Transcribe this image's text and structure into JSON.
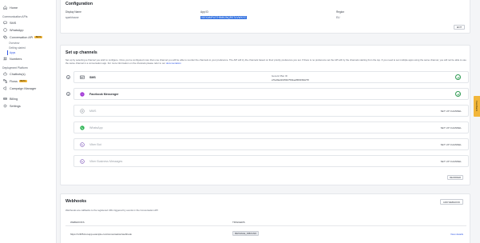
{
  "sidebar": {
    "top_items": [
      {
        "label": "Home",
        "icon": "home-icon"
      }
    ],
    "comm_section": "Communication APIs",
    "comm_items": [
      {
        "label": "SMS",
        "icon": "sms-icon"
      },
      {
        "label": "WhatsApp",
        "icon": "whatsapp-icon"
      },
      {
        "label": "Conversation API",
        "icon": "conversation-icon",
        "badge": "BETA"
      }
    ],
    "conv_sub": [
      {
        "label": "Overview"
      },
      {
        "label": "Getting started"
      },
      {
        "label": "Apps"
      }
    ],
    "numbers": {
      "label": "Numbers",
      "icon": "numbers-icon"
    },
    "deploy_section": "Deployment Platform",
    "deploy_items": [
      {
        "label": "Chatbots(s)",
        "icon": "chatbot-icon"
      },
      {
        "label": "Flows",
        "icon": "flows-icon",
        "badge": "BETA"
      },
      {
        "label": "Campaign Manager",
        "icon": "campaign-icon"
      }
    ],
    "bottom_items": [
      {
        "label": "Billing",
        "icon": "billing-icon"
      },
      {
        "label": "Settings",
        "icon": "settings-icon"
      }
    ]
  },
  "config": {
    "title": "Configuration",
    "display_name_label": "Display Name",
    "display_name_value": "sparkhouse",
    "app_id_label": "App ID",
    "app_id_value": "01EXAMPLE7H9MK2NQRSTUVWXYZ",
    "region_label": "Region",
    "region_value": "EU",
    "edit_label": "EDIT"
  },
  "channels": {
    "title": "Set up channels",
    "desc_line1": "Set up by selecting a channel you wish to configure. Once you've configured more than one channel you will be able to reorder the channels to your preference. The API will try the channels based on their priority preference you set. If there is no preference set the API will try the channels starting from the top. If you need to set multiple",
    "desc_line2": "apps using the same channel, you will not be able to use the same channel in a conversation app. For more information on the channels please refer to our",
    "desc_link": "documentation",
    "steps": [
      "1",
      "2"
    ],
    "configured": [
      {
        "name": "SMS",
        "meta_label": "Generic Plan ID",
        "meta_value": "a7fe29ad1b354b7592aef809036d278"
      },
      {
        "name": "Facebook Messenger"
      }
    ],
    "available": [
      {
        "name": "MMS",
        "action": "SET UP CHANNEL"
      },
      {
        "name": "WhatsApp",
        "action": "SET UP CHANNEL"
      },
      {
        "name": "Viber Bot",
        "action": "SET UP CHANNEL"
      },
      {
        "name": "Viber Business Messages",
        "action": "SET UP CHANNEL"
      }
    ],
    "reorder_label": "REORDER"
  },
  "webhooks": {
    "title": "Webhooks",
    "add_label": "ADD WEBHOOK",
    "desc": "Webhooks are callbacks to the registered URL triggered by events in the Conversation API",
    "col_webhook": "WEBHOOKS",
    "col_triggers": "TRIGGERS",
    "rows": [
      {
        "url": "https://rx365-bot.app.example.com/conversation/webhook",
        "trigger": "MESSAGE_INBOUND",
        "action": "View details"
      }
    ]
  },
  "feedback_label": "Feedback",
  "colors": {
    "accent": "#2f56e4",
    "success": "#2e9a52",
    "beta": "#f2b63a"
  }
}
